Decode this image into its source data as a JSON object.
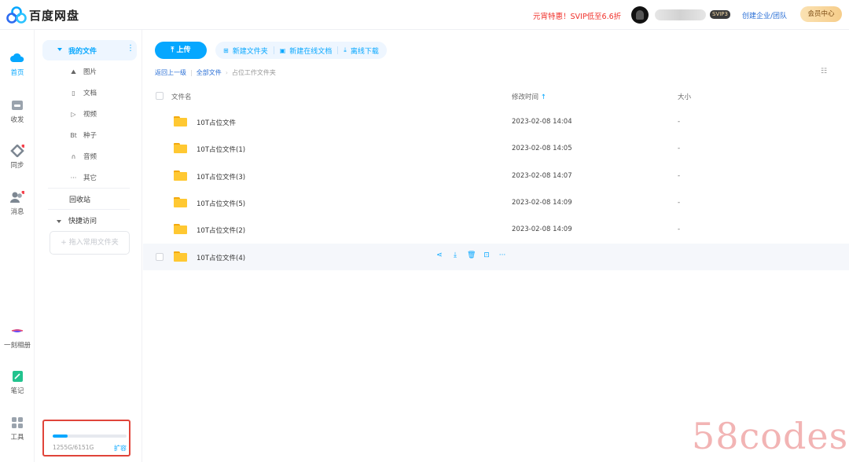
{
  "app": {
    "logo_text": "百度网盘"
  },
  "header": {
    "promo": "元宵特惠！SVIP低至6.6折",
    "svip_badge": "SVIP3",
    "create_team": "创建企业/团队",
    "member_center": "会员中心"
  },
  "rail": {
    "items": [
      {
        "label": "首页",
        "icon": "cloud-home-icon",
        "active": true
      },
      {
        "label": "收发",
        "icon": "inbox-icon"
      },
      {
        "label": "同步",
        "icon": "sync-icon",
        "badge": true
      },
      {
        "label": "消息",
        "icon": "contacts-icon",
        "badge": true
      },
      {
        "label": "一刻相册",
        "icon": "album-icon"
      },
      {
        "label": "笔记",
        "icon": "note-icon"
      },
      {
        "label": "工具",
        "icon": "apps-grid-icon"
      }
    ]
  },
  "sidebar": {
    "my_files": "我的文件",
    "categories": [
      {
        "label": "图片",
        "icon": "image-icon"
      },
      {
        "label": "文档",
        "icon": "document-icon"
      },
      {
        "label": "视频",
        "icon": "video-icon"
      },
      {
        "label": "种子",
        "icon": "bt-seed-icon"
      },
      {
        "label": "音频",
        "icon": "headphones-icon"
      },
      {
        "label": "其它",
        "icon": "more-icon"
      }
    ],
    "recycle_bin": "回收站",
    "quick_access": "快捷访问",
    "drag_hint": "+ 拖入常用文件夹",
    "quota": {
      "text": "1255G/6151G",
      "used_fraction": 0.204,
      "expand_label": "扩容"
    }
  },
  "toolbar": {
    "upload": "上传",
    "new_folder": "新建文件夹",
    "new_online_doc": "新建在线文档",
    "offline_download": "离线下载"
  },
  "breadcrumb": {
    "back": "返回上一级",
    "all_files": "全部文件",
    "current": "占位工作文件夹"
  },
  "table": {
    "columns": {
      "name": "文件名",
      "modified": "修改时间",
      "size": "大小"
    },
    "rows": [
      {
        "name": "10T占位文件",
        "modified": "2023-02-08 14:04",
        "size": "-"
      },
      {
        "name": "10T占位文件(1)",
        "modified": "2023-02-08 14:05",
        "size": "-"
      },
      {
        "name": "10T占位文件(3)",
        "modified": "2023-02-08 14:07",
        "size": "-"
      },
      {
        "name": "10T占位文件(5)",
        "modified": "2023-02-08 14:09",
        "size": "-"
      },
      {
        "name": "10T占位文件(2)",
        "modified": "2023-02-08 14:09",
        "size": "-"
      },
      {
        "name": "10T占位文件(4)",
        "modified": "",
        "size": ""
      }
    ]
  },
  "watermark": "58codes",
  "colors": {
    "accent": "#06a7ff",
    "promo": "#f0302a",
    "highlight_border": "#e0443a",
    "folder": "#ffc832"
  }
}
